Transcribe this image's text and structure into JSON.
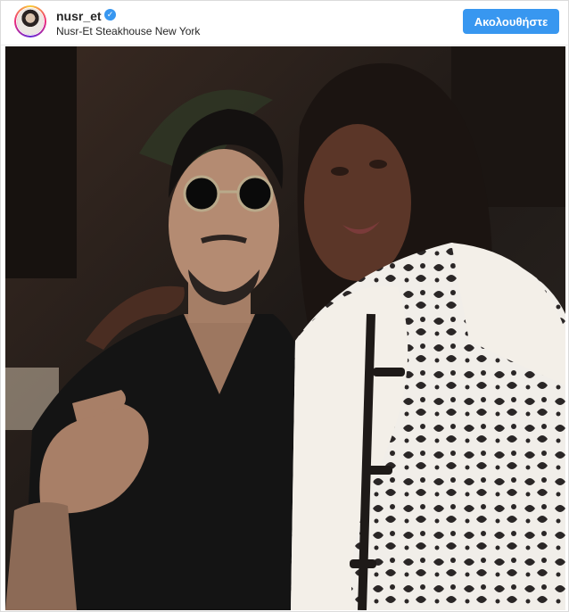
{
  "post": {
    "username": "nusr_et",
    "verified_icon": "verified-badge-icon",
    "location": "Nusr-Et Steakhouse New York",
    "follow_label": "Ακολουθήστε"
  },
  "colors": {
    "follow_button": "#3897f0",
    "verified_badge": "#3897f0"
  }
}
